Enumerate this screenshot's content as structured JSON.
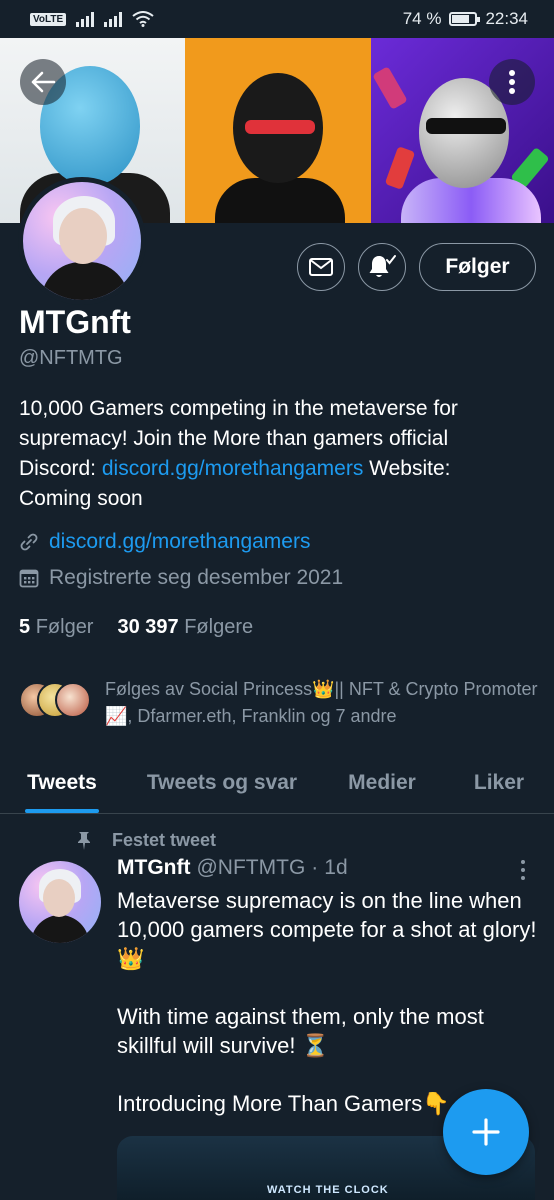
{
  "status_bar": {
    "volte": "VoLTE",
    "battery": "74 %",
    "battery_level": 0.74,
    "time": "22:34"
  },
  "banner": {
    "back_icon": "arrow-left-icon",
    "more_icon": "more-vertical-icon"
  },
  "actions": {
    "message_icon": "envelope-icon",
    "notify_icon": "bell-check-icon",
    "follow_label": "Følger"
  },
  "profile": {
    "name": "MTGnft",
    "handle": "@NFTMTG",
    "bio_pre": "10,000 Gamers competing in the metaverse for supremacy! Join the More than gamers official Discord: ",
    "bio_link": "discord.gg/morethangamers",
    "bio_post": " Website: Coming soon",
    "website": "discord.gg/morethangamers",
    "joined": "Registrerte seg desember 2021",
    "following_count": "5",
    "following_label": "Følger",
    "followers_count": "30 397",
    "followers_label": "Følgere",
    "followed_by": "Følges av Social Princess👑|| NFT & Crypto Promoter📈, Dfarmer.eth, Franklin og 7 andre"
  },
  "tabs": [
    "Tweets",
    "Tweets og svar",
    "Medier",
    "Liker"
  ],
  "active_tab": "Tweets",
  "tweet": {
    "pinned_label": "Festet tweet",
    "author": "MTGnft",
    "handle": "@NFTMTG",
    "dot": "·",
    "time": "1d",
    "para1": "Metaverse supremacy is on the line when 10,000 gamers compete for a shot at glory!👑",
    "para2": "With time against them, only the most skillful will survive! ⏳",
    "para3": "Introducing More Than Gamers👇",
    "media_sign": "WATCH THE CLOCK"
  },
  "fab": {
    "icon": "plus-icon"
  },
  "colors": {
    "background": "#15202b",
    "accent": "#1d9bf0",
    "muted": "#8b98a5",
    "divider": "#38444d"
  }
}
